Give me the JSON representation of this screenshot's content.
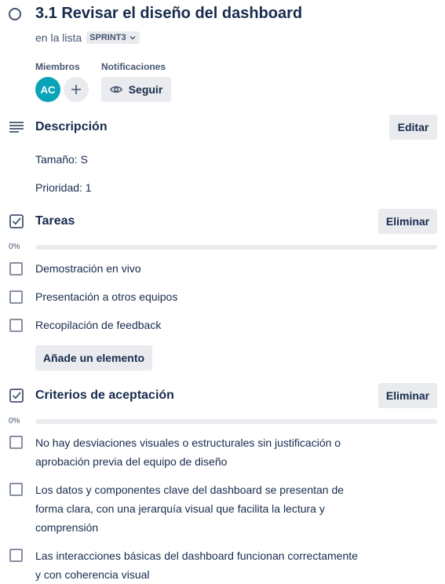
{
  "card": {
    "title": "3.1 Revisar el diseño del dashboard",
    "list_prefix": "en la lista",
    "list_name": "SPRINT3"
  },
  "members": {
    "label": "Miembros",
    "avatar_initials": "AC",
    "avatar_color": "#0aa4b9",
    "add_icon": "plus-icon"
  },
  "notifications": {
    "label": "Notificaciones",
    "follow_label": "Seguir",
    "follow_icon": "eye-icon"
  },
  "description": {
    "title": "Descripción",
    "edit_label": "Editar",
    "lines": [
      "Tamaño: S",
      "Prioridad: 1"
    ]
  },
  "checklists": [
    {
      "title": "Tareas",
      "delete_label": "Eliminar",
      "progress_label": "0%",
      "progress": 0,
      "items": [
        "Demostración en vivo",
        "Presentación a otros equipos",
        "Recopilación de feedback"
      ],
      "add_item_label": "Añade un elemento"
    },
    {
      "title": "Criterios de aceptación",
      "delete_label": "Eliminar",
      "progress_label": "0%",
      "progress": 0,
      "items": [
        "No hay desviaciones visuales o estructurales sin justificación o aprobación previa del equipo de diseño",
        "Los datos y componentes clave del dashboard se presentan de forma clara, con una jerarquía visual que facilita la lectura y comprensión",
        "Las interacciones básicas del dashboard funcionan correctamente y con coherencia visual"
      ]
    }
  ],
  "colors": {
    "text": "#172b4d",
    "subtle": "#44546f",
    "button_bg": "#e9ebee",
    "progress_fill": "#22a06b"
  }
}
